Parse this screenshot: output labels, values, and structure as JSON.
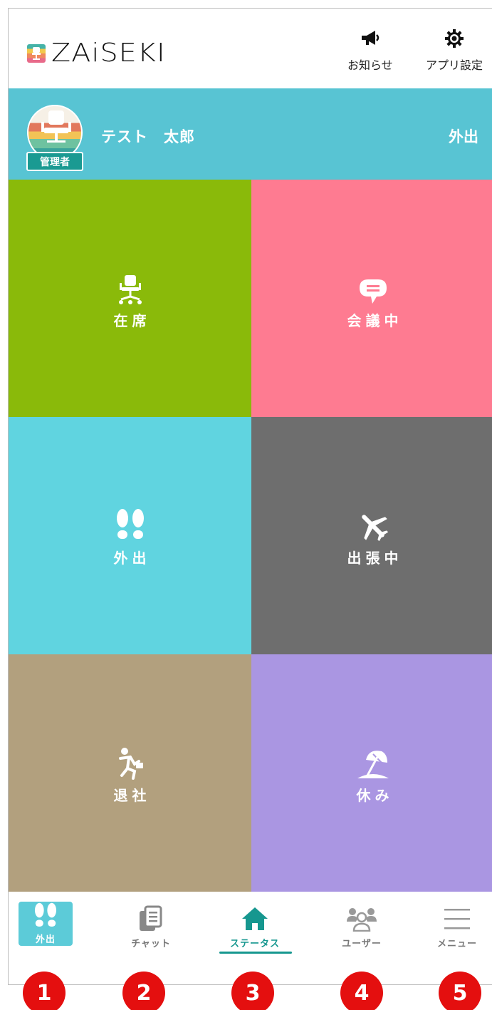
{
  "app": {
    "logo_text": "ZAiSEKI",
    "logo_mark": "™"
  },
  "header": {
    "notice": {
      "label": "お知らせ",
      "icon": "megaphone-icon"
    },
    "settings": {
      "label": "アプリ設定",
      "icon": "gear-icon"
    }
  },
  "user": {
    "name": "テスト　太郎",
    "role": "管理者",
    "status": "外出",
    "avatar_icon": "office-chair-icon"
  },
  "tiles": [
    {
      "label": "在席",
      "icon": "office-chair-icon",
      "color": "#8aba0a"
    },
    {
      "label": "会議中",
      "icon": "speech-bubble-icon",
      "color": "#fe7b91"
    },
    {
      "label": "外出",
      "icon": "footprints-icon",
      "color": "#60d4e0"
    },
    {
      "label": "出張中",
      "icon": "airplane-icon",
      "color": "#6e6e6e"
    },
    {
      "label": "退社",
      "icon": "running-person-icon",
      "color": "#b2a07e"
    },
    {
      "label": "休み",
      "icon": "beach-umbrella-icon",
      "color": "#aa96e2"
    }
  ],
  "nav": {
    "status": {
      "label": "外出",
      "icon": "footprints-icon"
    },
    "chat": {
      "label": "チャット",
      "icon": "chat-document-icon"
    },
    "stat": {
      "label": "ステータス",
      "icon": "home-icon"
    },
    "users": {
      "label": "ユーザー",
      "icon": "users-icon"
    },
    "menu": {
      "label": "メニュー",
      "icon": "hamburger-icon"
    }
  },
  "markers": [
    "1",
    "2",
    "3",
    "4",
    "5"
  ],
  "colors": {
    "accent": "#16978f",
    "header_bar": "#58c4d3",
    "marker": "#e40f0f"
  }
}
